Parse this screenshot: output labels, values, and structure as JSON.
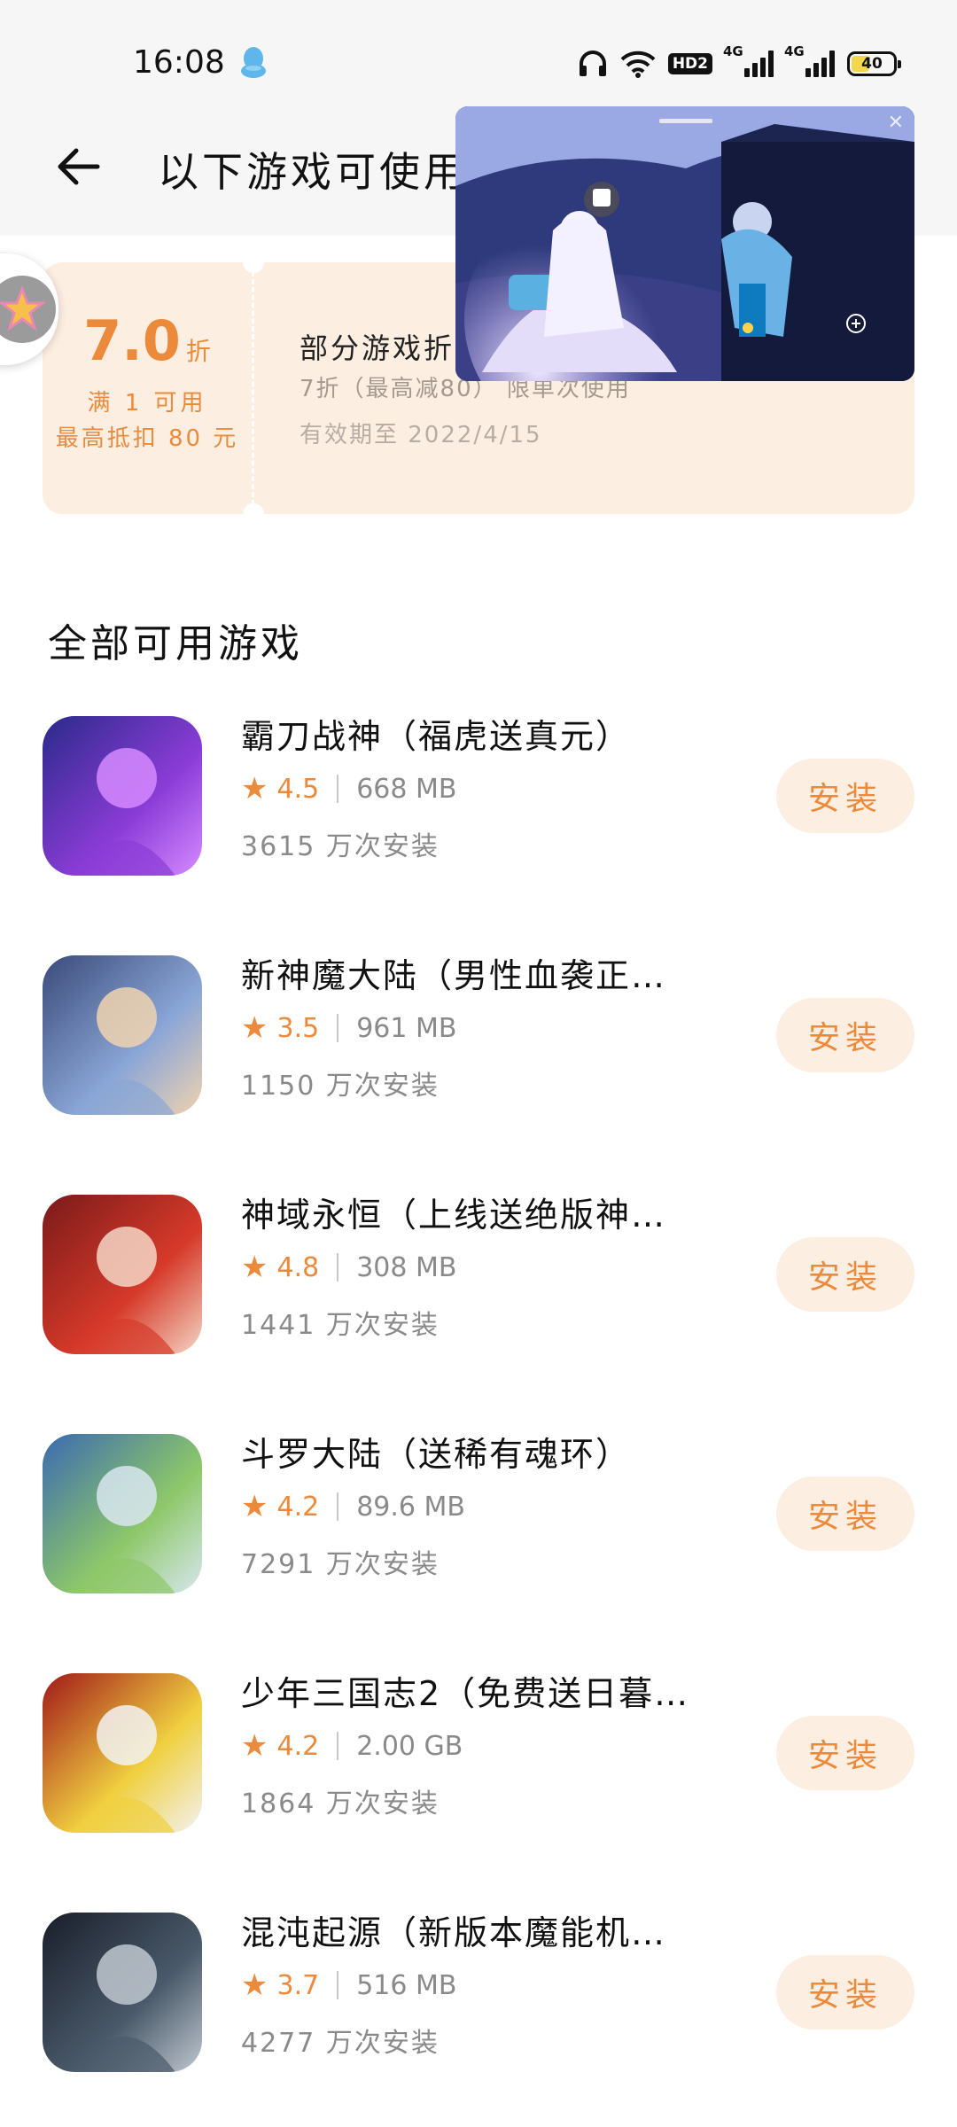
{
  "status_bar": {
    "time": "16:08",
    "network_badge": "HD2",
    "signal_1_label": "4G",
    "signal_2_label": "4G",
    "battery": "40"
  },
  "header": {
    "title": "以下游戏可使用"
  },
  "coupon": {
    "value": "7.0",
    "unit": "折",
    "condition": "满 1 可用",
    "max_discount": "最高抵扣 80 元",
    "title": "部分游戏折",
    "description": "7折（最高减80） 限单次使用",
    "expiry": "有效期至 2022/4/15"
  },
  "section": {
    "title": "全部可用游戏"
  },
  "games": [
    {
      "name": "霸刀战神（福虎送真元）",
      "rating": "4.5",
      "size": "668 MB",
      "installs": "3615 万次安装",
      "button": "安装",
      "icon_colors": [
        "#2a2a8a",
        "#8a3cd6",
        "#d68aff"
      ]
    },
    {
      "name": "新神魔大陆（男性血袭正…",
      "rating": "3.5",
      "size": "961 MB",
      "installs": "1150 万次安装",
      "button": "安装",
      "icon_colors": [
        "#3a4a7a",
        "#8aa6d6",
        "#f0d2b0"
      ]
    },
    {
      "name": "神域永恒（上线送绝版神…",
      "rating": "4.8",
      "size": "308 MB",
      "installs": "1441 万次安装",
      "button": "安装",
      "icon_colors": [
        "#7a1a1a",
        "#d63a2a",
        "#f5d6c6"
      ]
    },
    {
      "name": "斗罗大陆（送稀有魂环）",
      "rating": "4.2",
      "size": "89.6 MB",
      "installs": "7291 万次安装",
      "button": "安装",
      "icon_colors": [
        "#3a6ab0",
        "#8ec86a",
        "#d8e6f0"
      ]
    },
    {
      "name": "少年三国志2（免费送日暮…",
      "rating": "4.2",
      "size": "2.00 GB",
      "installs": "1864 万次安装",
      "button": "安装",
      "icon_colors": [
        "#a01818",
        "#f0d040",
        "#f2f2f2"
      ]
    },
    {
      "name": "混沌起源（新版本魔能机…",
      "rating": "3.7",
      "size": "516 MB",
      "installs": "4277 万次安装",
      "button": "安装",
      "icon_colors": [
        "#1a1e2a",
        "#4a5a6a",
        "#c0c8d0"
      ]
    }
  ]
}
